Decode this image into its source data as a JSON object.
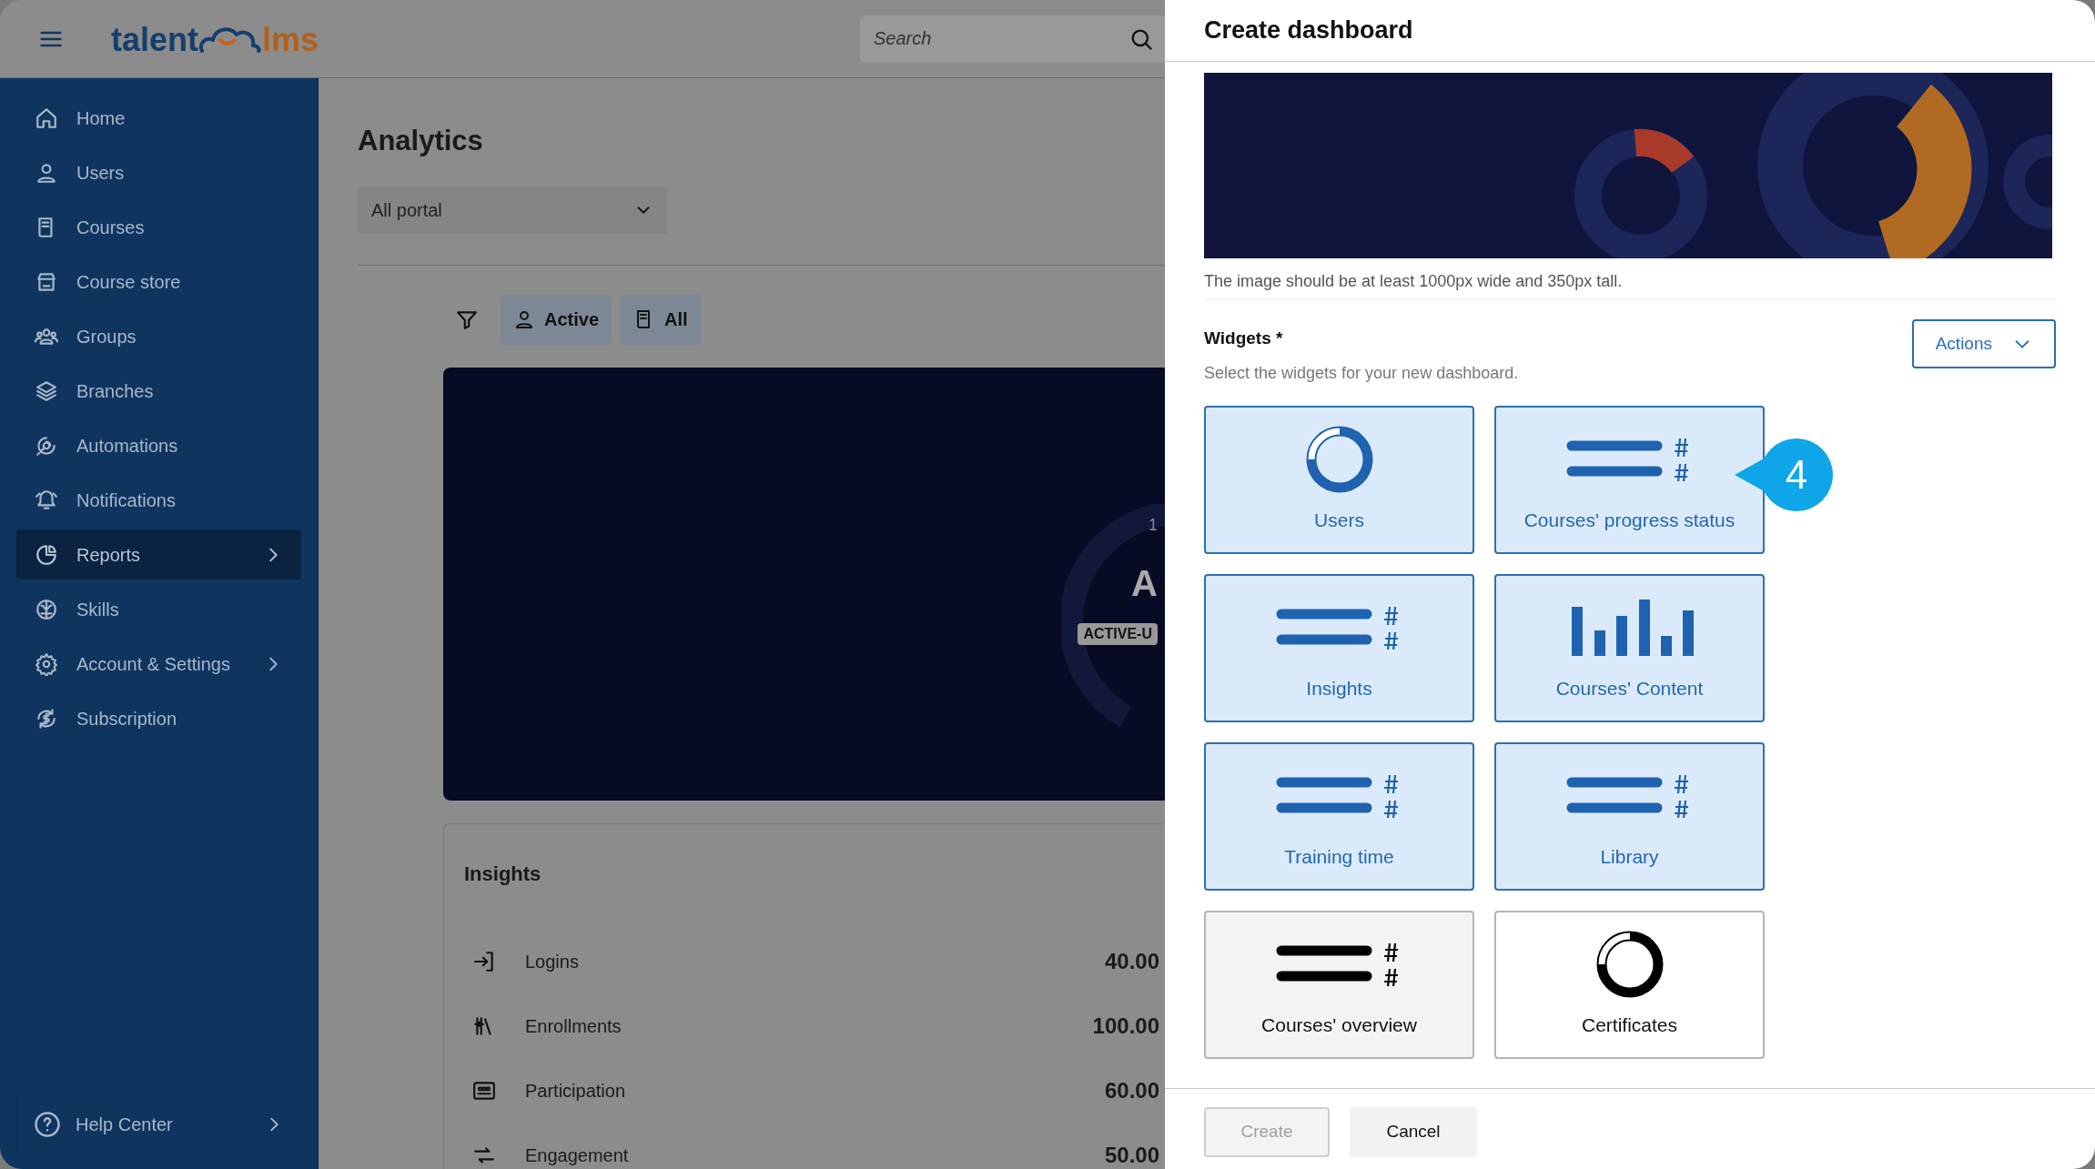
{
  "header": {
    "logo_left": "talent",
    "logo_right": "lms",
    "search": {
      "placeholder": "Search"
    }
  },
  "sidebar": {
    "items": [
      {
        "label": "Home",
        "selected": false,
        "submenu": false
      },
      {
        "label": "Users",
        "selected": false,
        "submenu": false
      },
      {
        "label": "Courses",
        "selected": false,
        "submenu": false
      },
      {
        "label": "Course store",
        "selected": false,
        "submenu": false
      },
      {
        "label": "Groups",
        "selected": false,
        "submenu": false
      },
      {
        "label": "Branches",
        "selected": false,
        "submenu": false
      },
      {
        "label": "Automations",
        "selected": false,
        "submenu": false
      },
      {
        "label": "Notifications",
        "selected": false,
        "submenu": false
      },
      {
        "label": "Reports",
        "selected": true,
        "submenu": true
      },
      {
        "label": "Skills",
        "selected": false,
        "submenu": false
      },
      {
        "label": "Account & Settings",
        "selected": false,
        "submenu": true
      },
      {
        "label": "Subscription",
        "selected": false,
        "submenu": false
      }
    ],
    "help": {
      "label": "Help Center"
    }
  },
  "main": {
    "title": "Analytics",
    "portal_select": {
      "value": "All portal"
    },
    "filters": [
      "Active",
      "All"
    ],
    "hero": {
      "small_text": "1",
      "big_text": "A",
      "badge": "ACTIVE-U"
    },
    "insights": {
      "title": "Insights",
      "rows": [
        {
          "label": "Logins",
          "value": "40.00"
        },
        {
          "label": "Enrollments",
          "value": "100.00"
        },
        {
          "label": "Participation",
          "value": "60.00"
        },
        {
          "label": "Engagement",
          "value": "50.00"
        }
      ]
    }
  },
  "dialog": {
    "title": "Create dashboard",
    "image_hint": "The image should be at least 1000px wide and 350px tall.",
    "widgets_label": "Widgets *",
    "widgets_help": "Select the widgets for your new dashboard.",
    "actions": "Actions",
    "widgets": [
      {
        "label": "Users",
        "kind": "donut",
        "selected": true,
        "hovered": false
      },
      {
        "label": "Courses' progress status",
        "kind": "lines",
        "selected": true,
        "hovered": false
      },
      {
        "label": "Insights",
        "kind": "lines",
        "selected": true,
        "hovered": false
      },
      {
        "label": "Courses' Content",
        "kind": "bars",
        "selected": true,
        "hovered": false
      },
      {
        "label": "Training time",
        "kind": "lines",
        "selected": true,
        "hovered": false
      },
      {
        "label": "Library",
        "kind": "lines",
        "selected": true,
        "hovered": false
      },
      {
        "label": "Courses' overview",
        "kind": "lines",
        "selected": false,
        "hovered": true
      },
      {
        "label": "Certificates",
        "kind": "donut",
        "selected": false,
        "hovered": false
      }
    ],
    "create": {
      "label": "Create",
      "disabled": true
    },
    "cancel": "Cancel"
  },
  "callout": {
    "label": "4"
  }
}
